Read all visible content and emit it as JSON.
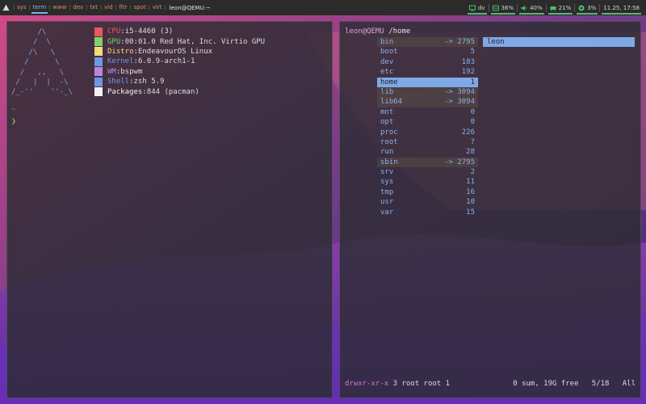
{
  "topbar": {
    "workspaces": [
      {
        "label": "sys",
        "active": false
      },
      {
        "label": "term",
        "active": true
      },
      {
        "label": "www",
        "active": false
      },
      {
        "label": "dev",
        "active": false
      },
      {
        "label": "txt",
        "active": false
      },
      {
        "label": "vid",
        "active": false
      },
      {
        "label": "fltr",
        "active": false
      },
      {
        "label": "spot",
        "active": false
      },
      {
        "label": "virt",
        "active": false
      }
    ],
    "window_title": "leon@QEMU:~",
    "modules": {
      "network": "dv",
      "disk": "36%",
      "volume": "40%",
      "memory": "21%",
      "cpu": "3%",
      "clock": "11.25, 17:58"
    }
  },
  "neofetch": {
    "logo": "      /\\\n     /  \\\n    /\\   \\\n   /      \\\n  /   ,,   \\\n /   |  |  -\\\n/_-''    ''-_\\",
    "rows": [
      {
        "key": "CPU",
        "value": "i5-4460 (3)",
        "color": "#e8595e"
      },
      {
        "key": "GPU",
        "value": "00:01.0 Red Hat, Inc. Virtio GPU",
        "color": "#7fd36a"
      },
      {
        "key": "Distro",
        "value": "EndeavourOS Linux",
        "color": "#f2dd7a"
      },
      {
        "key": "Kernel",
        "value": "6.0.9-arch1-1",
        "color": "#6f98e4"
      },
      {
        "key": "WM",
        "value": "bspwm",
        "color": "#b987e0"
      },
      {
        "key": "Shell",
        "value": "zsh 5.9",
        "color": "#6f98e4"
      },
      {
        "key": "Packages",
        "value": "844 (pacman)",
        "color": "#f2f2f2"
      }
    ],
    "tilde": "~",
    "prompt": "❯"
  },
  "filemanager": {
    "user": "leon@QEMU",
    "path": "/home",
    "entries": [
      {
        "name": "bin",
        "size": "-> 2795",
        "link": true,
        "selected": false
      },
      {
        "name": "boot",
        "size": "5",
        "link": false,
        "selected": false
      },
      {
        "name": "dev",
        "size": "183",
        "link": false,
        "selected": false
      },
      {
        "name": "etc",
        "size": "192",
        "link": false,
        "selected": false
      },
      {
        "name": "home",
        "size": "1",
        "link": false,
        "selected": true
      },
      {
        "name": "lib",
        "size": "-> 3094",
        "link": true,
        "selected": false
      },
      {
        "name": "lib64",
        "size": "-> 3094",
        "link": true,
        "selected": false
      },
      {
        "name": "mnt",
        "size": "0",
        "link": false,
        "selected": false
      },
      {
        "name": "opt",
        "size": "0",
        "link": false,
        "selected": false
      },
      {
        "name": "proc",
        "size": "226",
        "link": false,
        "selected": false
      },
      {
        "name": "root",
        "size": "?",
        "link": false,
        "selected": false
      },
      {
        "name": "run",
        "size": "28",
        "link": false,
        "selected": false
      },
      {
        "name": "sbin",
        "size": "-> 2795",
        "link": true,
        "selected": false
      },
      {
        "name": "srv",
        "size": "2",
        "link": false,
        "selected": false
      },
      {
        "name": "sys",
        "size": "11",
        "link": false,
        "selected": false
      },
      {
        "name": "tmp",
        "size": "16",
        "link": false,
        "selected": false
      },
      {
        "name": "usr",
        "size": "10",
        "link": false,
        "selected": false
      },
      {
        "name": "var",
        "size": "15",
        "link": false,
        "selected": false
      }
    ],
    "preview_item": "leon",
    "status": {
      "permissions": "drwxr-xr-x",
      "owner": "3 root root 1",
      "summary": "0 sum, 19G free",
      "position": "5/18",
      "scroll": "All"
    }
  }
}
